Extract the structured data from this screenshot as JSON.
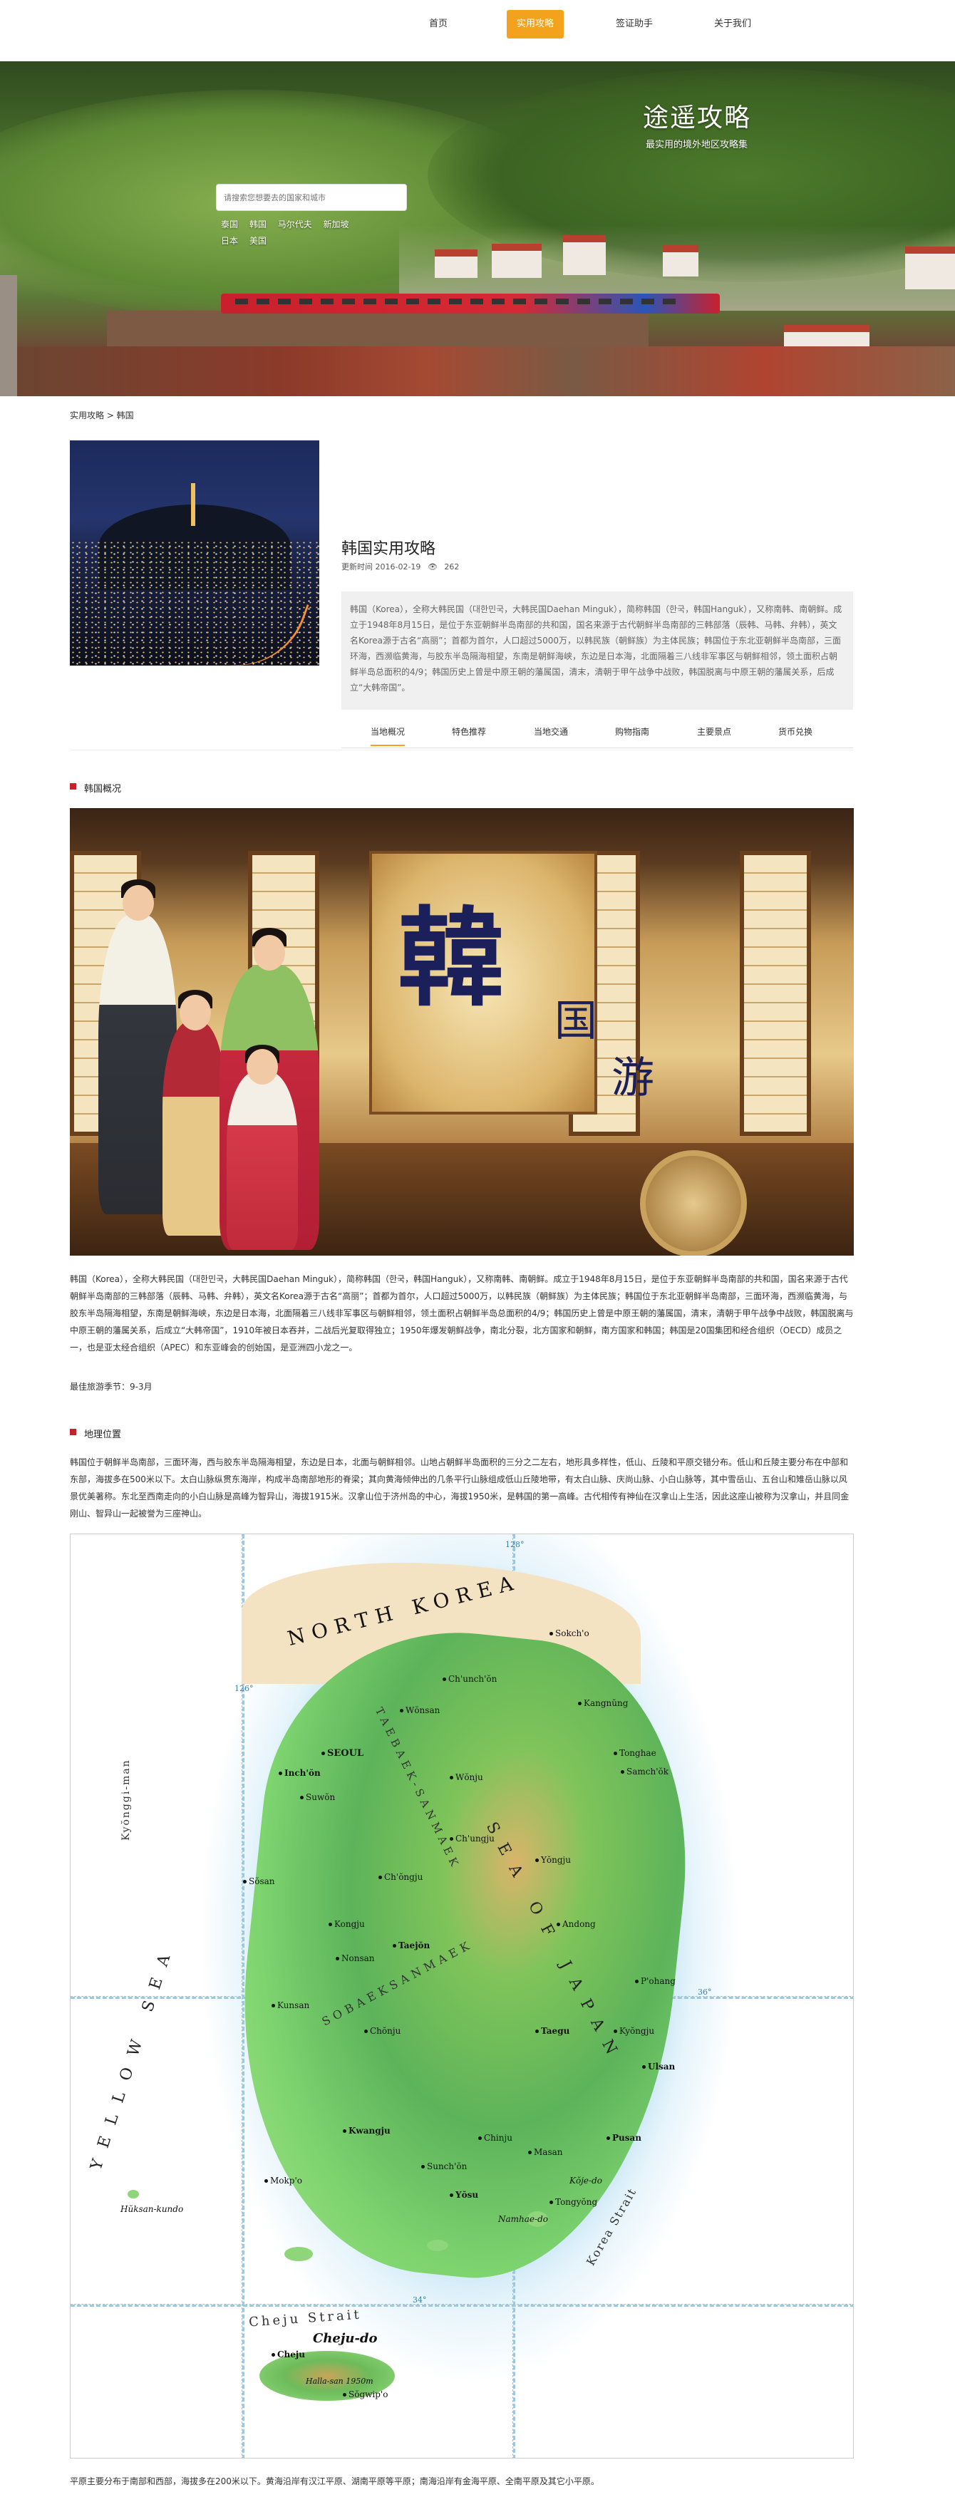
{
  "nav": {
    "items": [
      {
        "label": "首页",
        "active": false
      },
      {
        "label": "实用攻略",
        "active": true
      },
      {
        "label": "签证助手",
        "active": false
      },
      {
        "label": "关于我们",
        "active": false
      }
    ]
  },
  "hero": {
    "title": "途遥攻略",
    "subtitle": "最实用的境外地区攻略集",
    "search_placeholder": "请搜索您想要去的国家和城市",
    "hot_tags": [
      "泰国",
      "韩国",
      "马尔代夫",
      "新加坡",
      "日本",
      "美国"
    ]
  },
  "breadcrumb": "实用攻略 > 韩国",
  "destination": {
    "title": "韩国实用攻略",
    "updated": "更新时间 2016-02-19",
    "views": "262",
    "eye_icon": "eye-icon",
    "intro": "韩国（Korea），全称大韩民国（대한민국，大韩民国Daehan Minguk），简称韩国（한국，韩国Hanguk），又称南韩、南朝鲜。成立于1948年8月15日，是位于东亚朝鲜半岛南部的共和国，国名来源于古代朝鲜半岛南部的三韩部落（辰韩、马韩、弁韩），英文名Korea源于古名“高丽”；首都为首尔，人口超过5000万，以韩民族（朝鲜族）为主体民族；韩国位于东北亚朝鲜半岛南部，三面环海，西濒临黄海，与胶东半岛隔海相望，东南是朝鲜海峡，东边是日本海，北面隔着三八线非军事区与朝鲜相邻，领土面积占朝鲜半岛总面积的4/9；韩国历史上曾是中原王朝的藩属国，清末，清朝于甲午战争中战败，韩国脱离与中原王朝的藩属关系，后成立“大韩帝国”。"
  },
  "subtabs": [
    {
      "label": "当地概况",
      "active": true
    },
    {
      "label": "特色推荐",
      "active": false
    },
    {
      "label": "当地交通",
      "active": false
    },
    {
      "label": "购物指南",
      "active": false
    },
    {
      "label": "主要景点",
      "active": false
    },
    {
      "label": "货币兑换",
      "active": false
    }
  ],
  "overview": {
    "heading": "韩国概况",
    "banner_chars": {
      "han": "韓",
      "guo": "国",
      "you": "游"
    },
    "paragraph": "韩国（Korea），全称大韩民国（대한민국，大韩民国Daehan Minguk），简称韩国（한국，韩国Hanguk），又称南韩、南朝鲜。成立于1948年8月15日，是位于东亚朝鲜半岛南部的共和国，国名来源于古代朝鲜半岛南部的三韩部落（辰韩、马韩、弁韩），英文名Korea源于古名“高丽”；首都为首尔，人口超过5000万，以韩民族（朝鲜族）为主体民族；韩国位于东北亚朝鲜半岛南部，三面环海，西濒临黄海，与胶东半岛隔海相望，东南是朝鲜海峡，东边是日本海，北面隔着三八线非军事区与朝鲜相邻，领土面积占朝鲜半岛总面积的4/9；韩国历史上曾是中原王朝的藩属国，清末，清朝于甲午战争中战败，韩国脱离与中原王朝的藩属关系，后成立“大韩帝国”，1910年被日本吞并，二战后光复取得独立；1950年爆发朝鲜战争，南北分裂，北方国家和朝鲜，南方国家和韩国；韩国是20国集团和经合组织（OECD）成员之一，也是亚太经合组织（APEC）和东亚峰会的创始国，是亚洲四小龙之一。",
    "best_season": "最佳旅游季节：9-3月"
  },
  "geography": {
    "heading": "地理位置",
    "paragraph": "韩国位于朝鲜半岛南部，三面环海，西与胶东半岛隔海相望，东边是日本，北面与朝鲜相邻。山地占朝鲜半岛面积的三分之二左右，地形具多样性，低山、丘陵和平原交错分布。低山和丘陵主要分布在中部和东部，海拔多在500米以下。太白山脉纵贯东海岸，构成半岛南部地形的脊梁；其向黄海倾伸出的几条平行山脉组成低山丘陵地带，有太白山脉、庆尚山脉、小白山脉等，其中雪岳山、五台山和雉岳山脉以风景优美著称。东北至西南走向的小白山脉是高峰为智异山，海拔1915米。汉拿山位于济州岛的中心，海拔1950米，是韩国的第一高峰。古代相传有神仙在汉拿山上生活，因此这座山被称为汉拿山，并且同金刚山、智异山一起被誉为三座神山。",
    "footer": "平原主要分布于南部和西部，海拔多在200米以下。黄海沿岸有汉江平原、湖南平原等平原；南海沿岸有金海平原、全南平原及其它小平原。"
  },
  "map": {
    "labels": {
      "north": "NORTH KOREA",
      "yellow_sea": "YELLOW SEA",
      "sea_of_japan": "SEA OF JAPAN",
      "sobaeksanmaek": "SOBAEKSANMAEK",
      "taebaek": "TAEBAEK-SANMAEK",
      "cheju_strait": "Cheju Strait",
      "korea_strait": "Korea Strait",
      "kyonggi_man": "Kyŏnggi-man",
      "lon128": "128°",
      "lon126": "126°",
      "lat36": "36°",
      "lat34": "34°"
    },
    "cities": [
      "SEOUL",
      "Inch'ŏn",
      "Suwŏn",
      "Ch'unch'ŏn",
      "Kangnŭng",
      "Sokch'o",
      "Tonghae",
      "Samch'ŏk",
      "Wŏnju",
      "Ch'ŏngju",
      "Taejŏn",
      "Kongju",
      "Nonsan",
      "Chŏnju",
      "Kunsan",
      "Kwangju",
      "Mokp'o",
      "Yŏsu",
      "Sunch'ŏn",
      "Chinju",
      "Masan",
      "Pusan",
      "Ulsan",
      "Taegu",
      "Kyŏngju",
      "P'ohang",
      "Andong",
      "Yŏngju",
      "Ch'ungju",
      "Wŏnsan",
      "Sŏsan",
      "Tongyŏng",
      "Cheju",
      "Sŏgwip'o"
    ],
    "jeju": "Cheju-do",
    "hallasan": "Halla-san 1950m",
    "heuksan": "Hŭksan-kundo",
    "namhae": "Namhae-do",
    "geoje": "Kŏje-do"
  }
}
